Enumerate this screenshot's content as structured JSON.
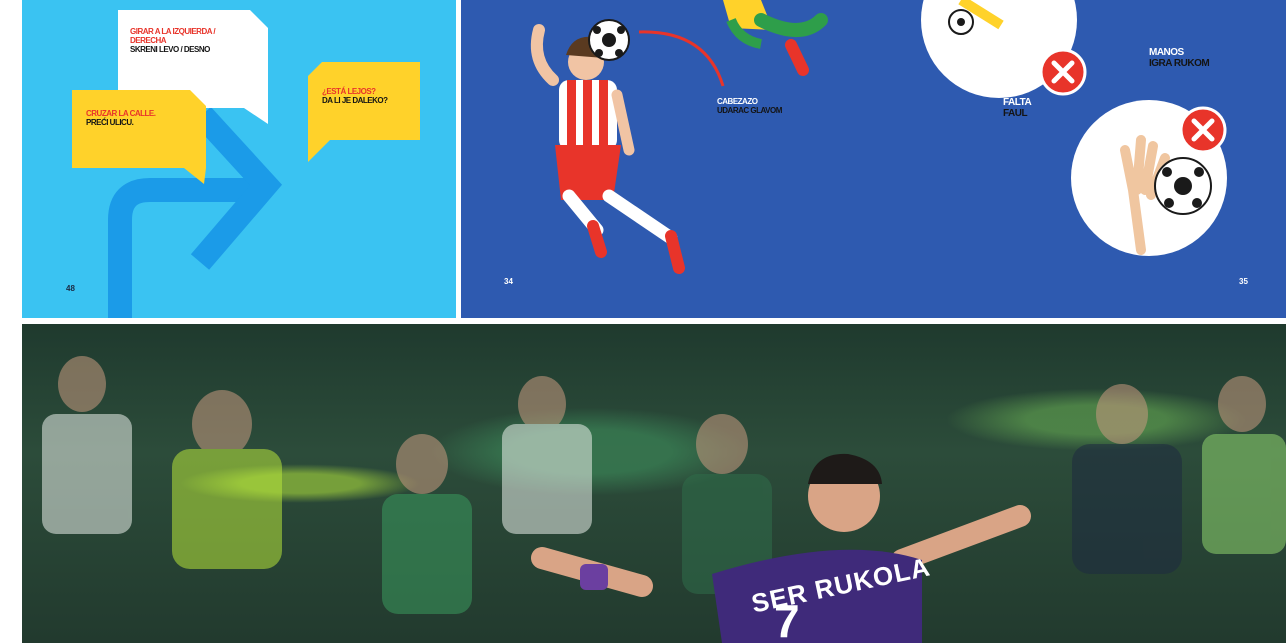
{
  "left_page": {
    "bubble_white": {
      "line_es": "GIRAR A LA IZQUIERDA / DERECHA",
      "line_sr": "SKRENI LEVO / DESNO"
    },
    "bubble_yellow_left": {
      "line_es": "CRUZAR LA CALLE.",
      "line_sr": "PREĆI ULICU."
    },
    "bubble_yellow_right": {
      "line_es": "¿ESTÁ LEJOS?",
      "line_sr": "DA LI JE DALEKO?"
    },
    "page_number": "48"
  },
  "right_page": {
    "heading_caption": {
      "line_es": "CABEZAZO",
      "line_sr": "UDARAC GLAVOM"
    },
    "foul_caption": {
      "line_es": "FALTA",
      "line_sr": "FAUL"
    },
    "hands_caption": {
      "line_es": "MANOS",
      "line_sr": "IGRA RUKOM"
    },
    "page_number_left": "34",
    "page_number_right": "35"
  },
  "photo": {
    "shirt_name": "SER RUKOLA",
    "shirt_number": "7"
  },
  "colors": {
    "sky": "#3ac3f2",
    "royal_blue": "#2e5ab0",
    "bubble_yellow": "#ffd22a",
    "arrow_blue": "#1b9be8",
    "accent_red": "#e8342a",
    "kit_purple": "#3f2a7a"
  }
}
